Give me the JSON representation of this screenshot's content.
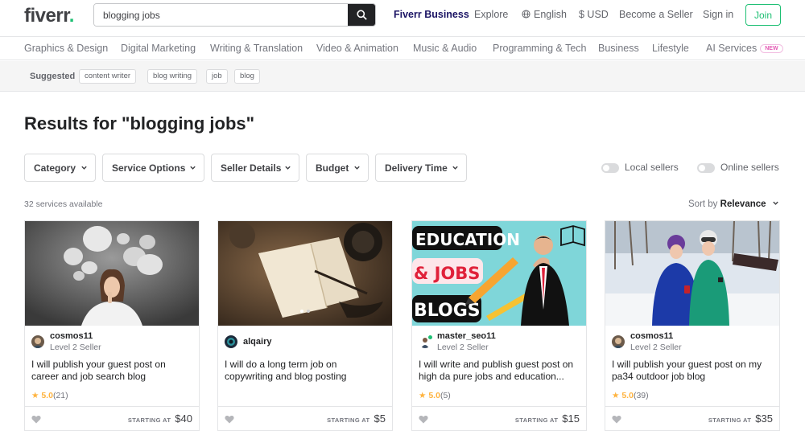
{
  "header": {
    "logo_text": "fiverr",
    "logo_dot": ".",
    "search_value": "blogging jobs",
    "nav": {
      "business": "Fiverr Business",
      "explore": "Explore",
      "language": "English",
      "currency": "$ USD",
      "become_seller": "Become a Seller",
      "sign_in": "Sign in",
      "join": "Join"
    }
  },
  "categories": [
    "Graphics & Design",
    "Digital Marketing",
    "Writing & Translation",
    "Video & Animation",
    "Music & Audio",
    "Programming & Tech",
    "Business",
    "Lifestyle",
    "AI Services"
  ],
  "categories_new_badge": "NEW",
  "suggested": {
    "label": "Suggested",
    "chips": [
      "content writer",
      "blog writing",
      "job",
      "blog"
    ]
  },
  "results": {
    "title": "Results for \"blogging jobs\"",
    "filters": [
      "Category",
      "Service Options",
      "Seller Details",
      "Budget",
      "Delivery Time"
    ],
    "toggles": [
      "Local sellers",
      "Online sellers"
    ],
    "count": "32 services available",
    "sort_label": "Sort by",
    "sort_value": "Relevance"
  },
  "gigs": [
    {
      "seller": "cosmos11",
      "level": "Level 2 Seller",
      "title": "I will publish your guest post on career and job search blog",
      "rating": "5.0",
      "reviews": "(21)",
      "starting_at": "STARTING AT",
      "price": "$40"
    },
    {
      "seller": "alqairy",
      "level": "",
      "title": "I will do a long term job on copywriting and blog posting",
      "rating": "",
      "reviews": "",
      "starting_at": "STARTING AT",
      "price": "$5"
    },
    {
      "seller": "master_seo11",
      "level": "Level 2 Seller",
      "title": "I will write and publish guest post on high da pure jobs and education...",
      "rating": "5.0",
      "reviews": "(5)",
      "starting_at": "STARTING AT",
      "price": "$15",
      "thumb_text": [
        "EDUCATION",
        "& JOBS",
        "BLOGS"
      ]
    },
    {
      "seller": "cosmos11",
      "level": "Level 2 Seller",
      "title": "I will publish your guest post on my pa34 outdoor job blog",
      "rating": "5.0",
      "reviews": "(39)",
      "starting_at": "STARTING AT",
      "price": "$35"
    }
  ],
  "colors": {
    "brand_green": "#1dbf73",
    "business_blue": "#1b1464",
    "star": "#ffb33e"
  }
}
